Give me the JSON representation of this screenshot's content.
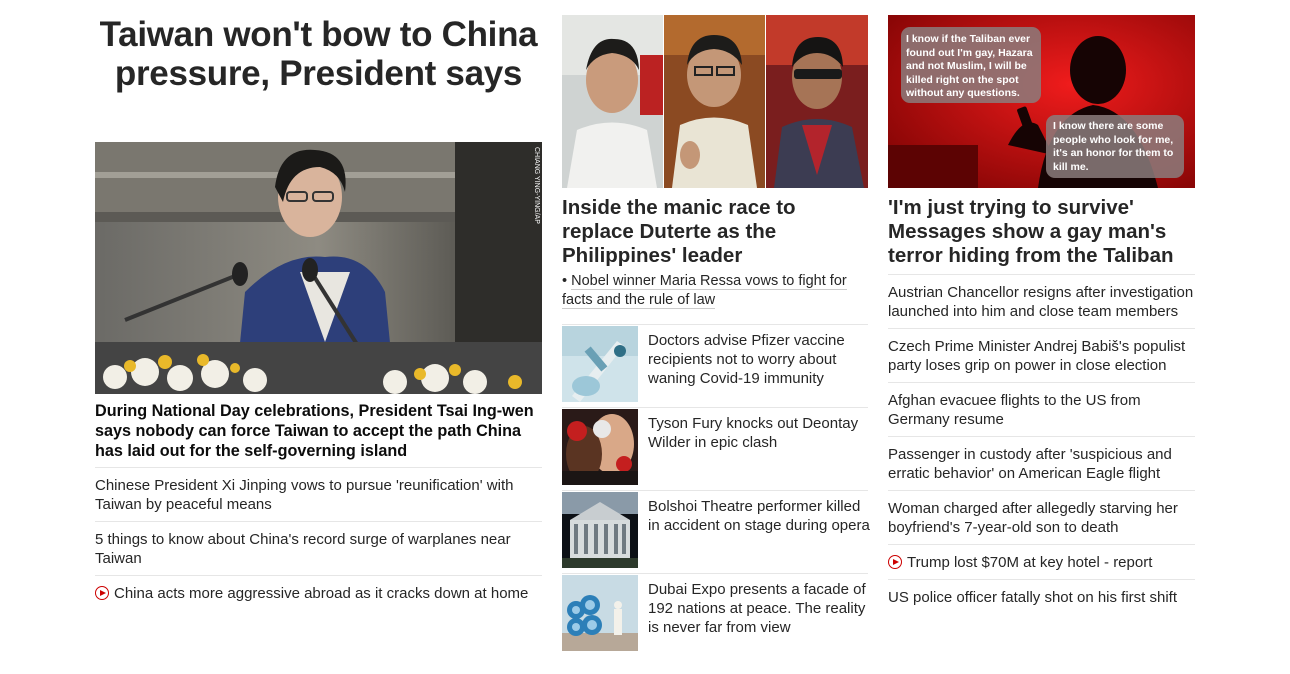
{
  "lead": {
    "title": "Taiwan won't bow to China pressure, President says",
    "photo_credit": "CHIANG YING-YING/AP",
    "description": "During National Day celebrations, President Tsai Ing-wen says nobody can force Taiwan to accept the path China has laid out for the self-governing island",
    "related": [
      {
        "text": "Chinese President Xi Jinping vows to pursue 'reunification' with Taiwan by peaceful means",
        "video": false
      },
      {
        "text": "5 things to know about China's record surge of warplanes near Taiwan",
        "video": false
      },
      {
        "text": "China acts more aggressive abroad as it cracks down at home",
        "video": true
      }
    ]
  },
  "middle": {
    "feature_title": "Inside the manic race to replace Duterte as the Philippines' leader",
    "feature_sub": "Nobel winner Maria Ressa vows to fight for facts and the rule of law",
    "cards": [
      {
        "text": "Doctors advise Pfizer vaccine recipients not to worry about waning Covid-19 immunity",
        "thumb": "vaccine-syringe"
      },
      {
        "text": "Tyson Fury knocks out Deontay Wilder in epic clash",
        "thumb": "boxing"
      },
      {
        "text": "Bolshoi Theatre performer killed in accident on stage during opera",
        "thumb": "bolshoi-theatre"
      },
      {
        "text": "Dubai Expo presents a facade of 192 nations at peace. The reality is never far from view",
        "thumb": "expo-2020-sign"
      }
    ]
  },
  "right": {
    "bubble1": "I know if the Taliban ever found out I'm gay, Hazara and not Muslim, I will be killed right on the spot without any questions.",
    "bubble2": "I know there are some people who look for me, it's an honor for them to kill me.",
    "feature_title": "'I'm just trying to survive' Messages show a gay man's terror hiding from the Taliban",
    "list": [
      {
        "text": "Austrian Chancellor resigns after investigation launched into him and close team members",
        "video": false
      },
      {
        "text": "Czech Prime Minister Andrej Babiš's populist party loses grip on power in close election",
        "video": false
      },
      {
        "text": "Afghan evacuee flights to the US from Germany resume",
        "video": false
      },
      {
        "text": "Passenger in custody after 'suspicious and erratic behavior' on American Eagle flight",
        "video": false
      },
      {
        "text": "Woman charged after allegedly starving her boyfriend's 7-year-old son to death",
        "video": false
      },
      {
        "text": "Trump lost $70M at key hotel - report",
        "video": true
      },
      {
        "text": "US police officer fatally shot on his first shift",
        "video": false
      }
    ]
  },
  "colors": {
    "accent": "#cc0000",
    "text": "#262626",
    "divider": "#e6e6e6"
  }
}
